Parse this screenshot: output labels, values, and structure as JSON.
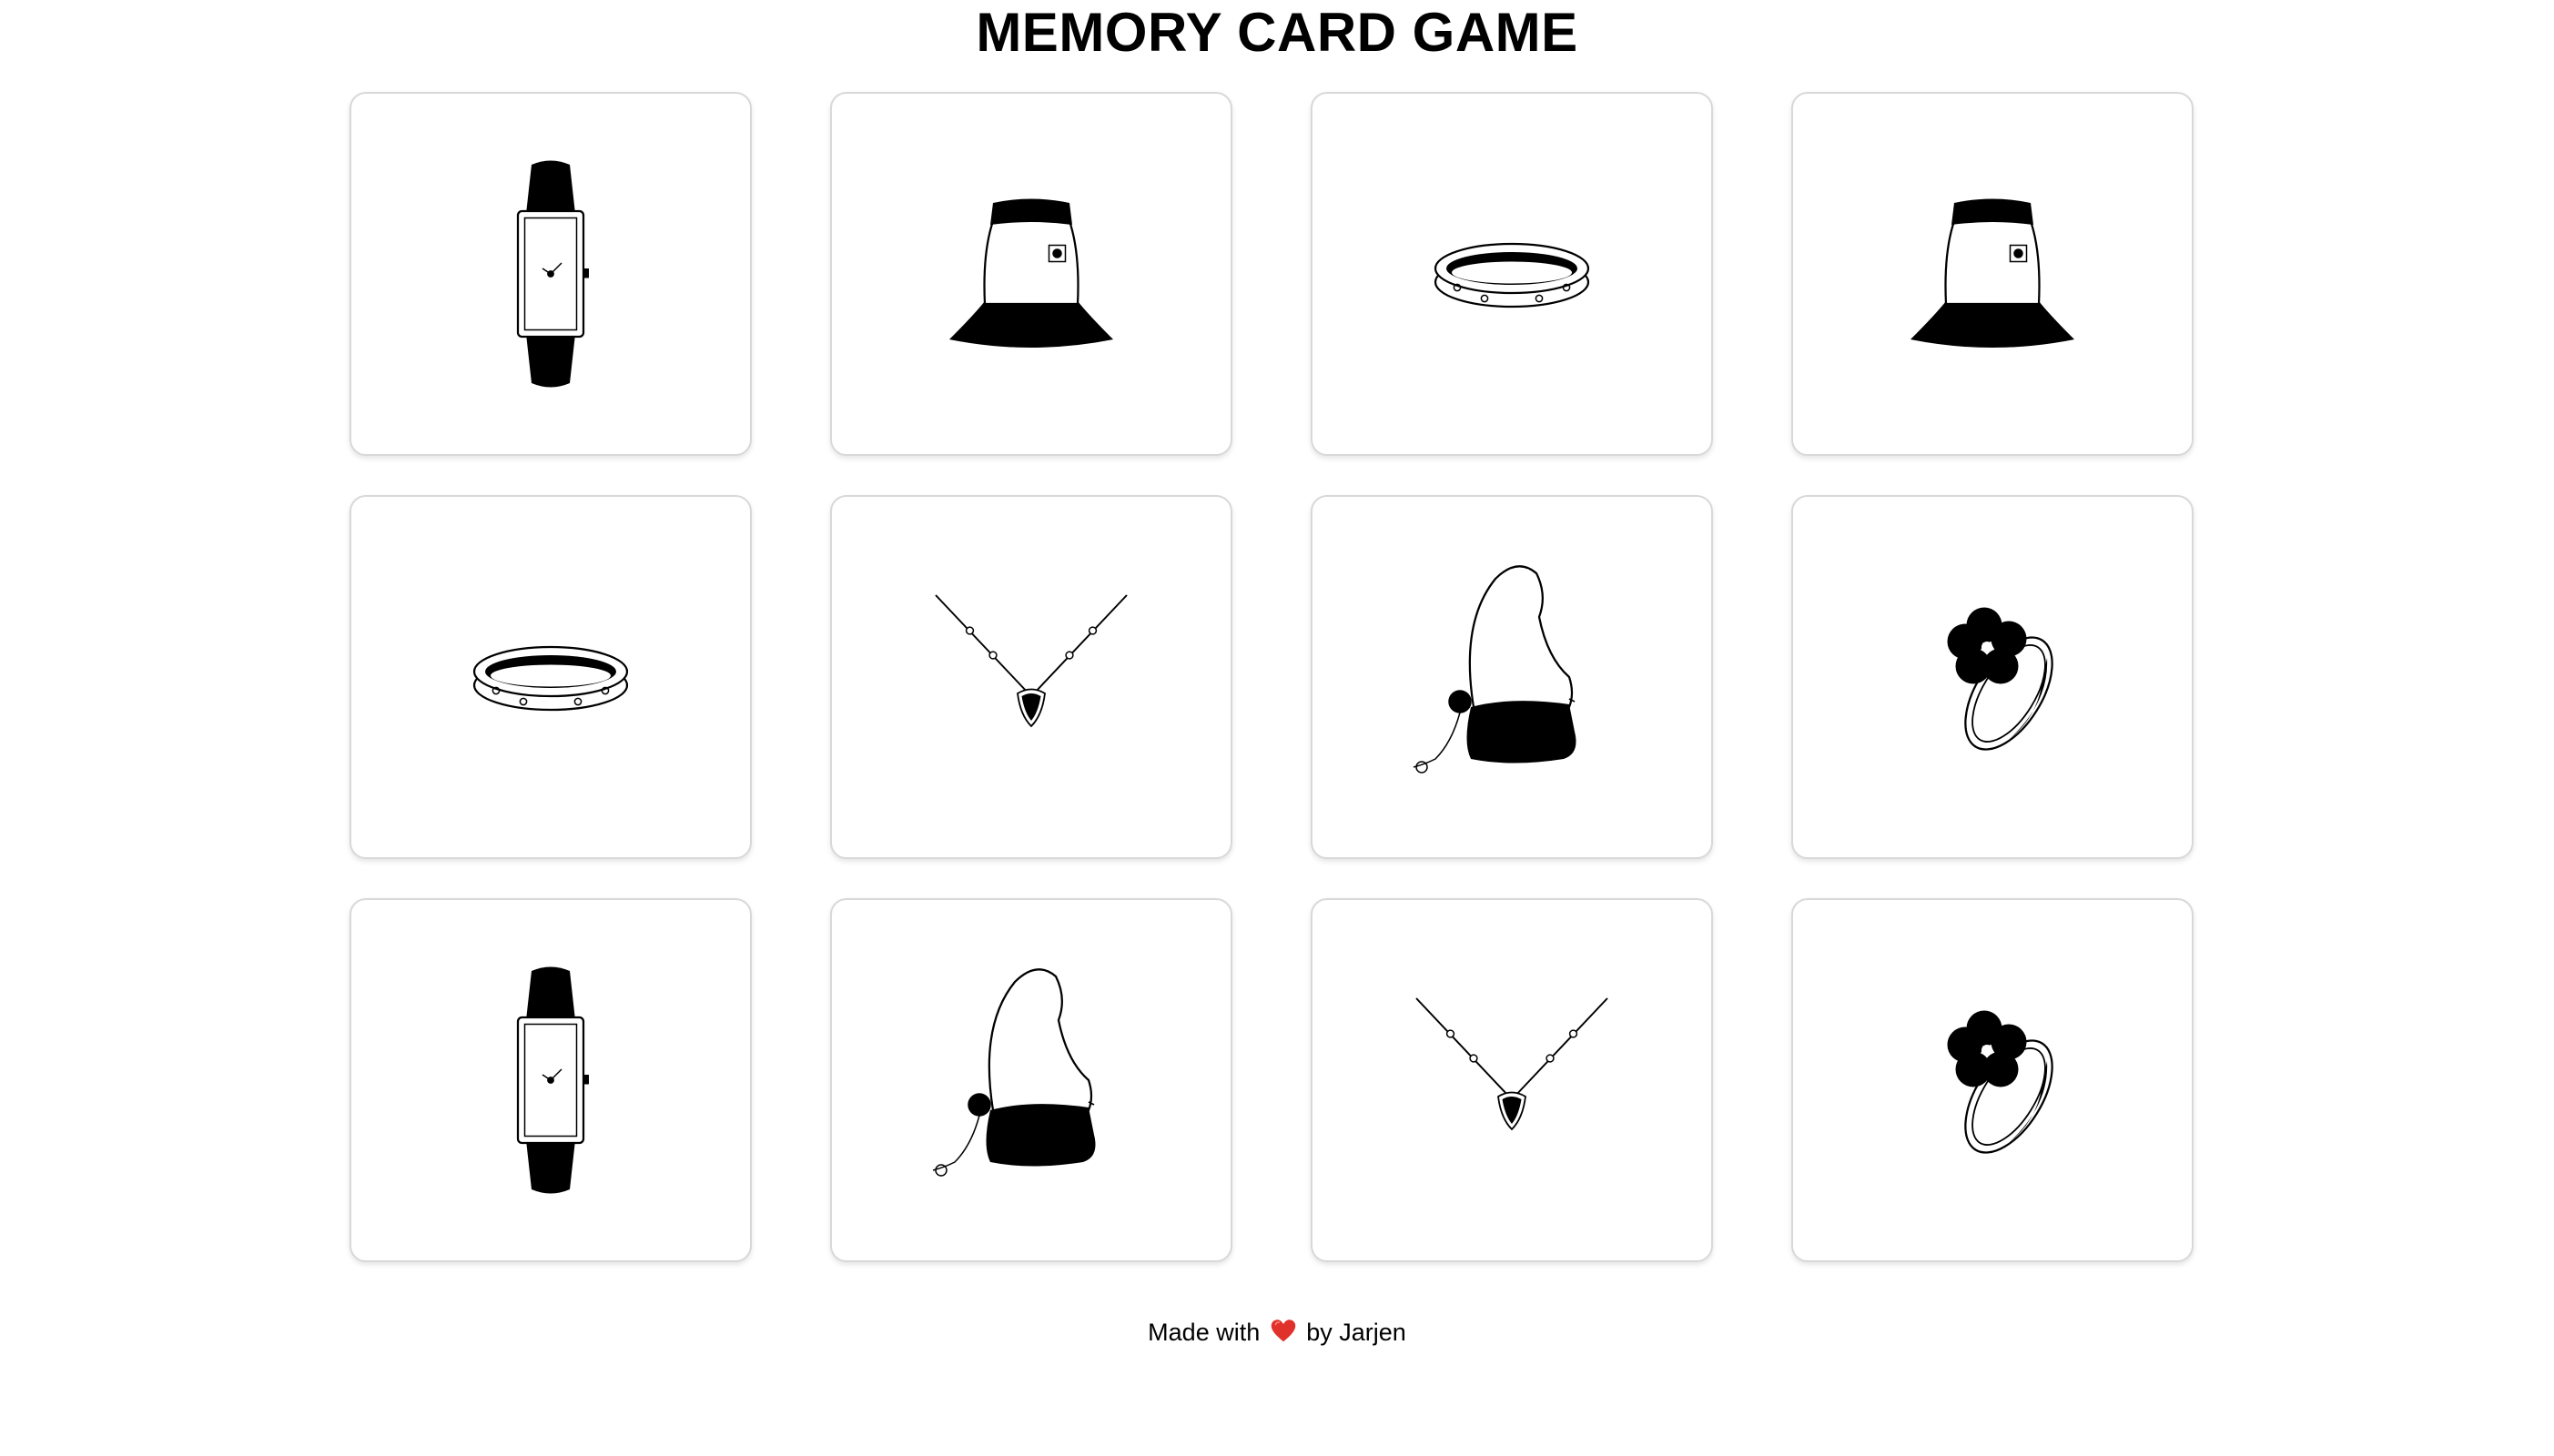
{
  "header": {
    "title": "MEMORY CARD GAME"
  },
  "board": {
    "rows": 3,
    "columns": 4,
    "cards": [
      {
        "row": 1,
        "col": 1,
        "item": "watch",
        "icon": "watch-icon"
      },
      {
        "row": 1,
        "col": 2,
        "item": "bucket-hat",
        "icon": "bucket-hat-icon"
      },
      {
        "row": 1,
        "col": 3,
        "item": "bracelet",
        "icon": "bracelet-icon"
      },
      {
        "row": 1,
        "col": 4,
        "item": "bucket-hat",
        "icon": "bucket-hat-icon"
      },
      {
        "row": 2,
        "col": 1,
        "item": "bracelet",
        "icon": "bracelet-icon"
      },
      {
        "row": 2,
        "col": 2,
        "item": "necklace",
        "icon": "necklace-icon"
      },
      {
        "row": 2,
        "col": 3,
        "item": "beanie-hat",
        "icon": "beanie-hat-icon"
      },
      {
        "row": 2,
        "col": 4,
        "item": "flower-ring",
        "icon": "flower-ring-icon"
      },
      {
        "row": 3,
        "col": 1,
        "item": "watch",
        "icon": "watch-icon"
      },
      {
        "row": 3,
        "col": 2,
        "item": "beanie-hat",
        "icon": "beanie-hat-icon"
      },
      {
        "row": 3,
        "col": 3,
        "item": "necklace",
        "icon": "necklace-icon"
      },
      {
        "row": 3,
        "col": 4,
        "item": "flower-ring",
        "icon": "flower-ring-icon"
      }
    ]
  },
  "footer": {
    "prefix": "Made with",
    "heart_icon": "heart-icon",
    "suffix": "by Jarjen"
  },
  "colors": {
    "background": "#ffffff",
    "ink": "#000000",
    "card_border": "#d8d8d8",
    "heart": "#e0312b"
  }
}
